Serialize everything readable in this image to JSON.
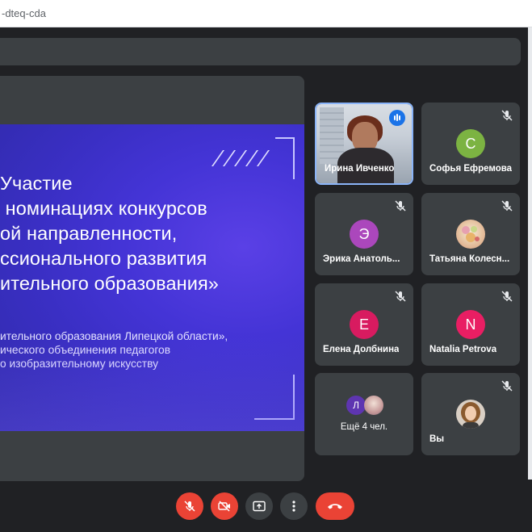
{
  "browser": {
    "url_fragment": "-dteq-cda"
  },
  "presentation": {
    "title_lines": "Участие\n номинациях конкурсов\nой направленности,\nссионального развития\nительного образования»",
    "subtitle_lines": "ительного образования Липецкой области»,\nического объединения педагогов\nо изобразительному искусству"
  },
  "participants": [
    {
      "name": "Ирина Ивченко",
      "kind": "video",
      "speaking": true
    },
    {
      "name": "Софья Ефремова",
      "initial": "С",
      "color": "#7cb342",
      "muted": true
    },
    {
      "name": "Эрика Анатоль...",
      "initial": "Э",
      "color": "#ab47bc",
      "muted": true
    },
    {
      "name": "Татьяна Колесн...",
      "kind": "photo",
      "muted": true
    },
    {
      "name": "Елена Долбнина",
      "initial": "Е",
      "color": "#d81b60",
      "muted": true
    },
    {
      "name": "Natalia Petrova",
      "initial": "N",
      "color": "#e91e63",
      "muted": true
    },
    {
      "name": "Ещё 4 чел.",
      "kind": "more",
      "mini_initial": "Л",
      "mini_color": "#5e35b1"
    },
    {
      "name": "Вы",
      "kind": "photo",
      "muted": true
    }
  ],
  "colors": {
    "control_red": "#ea4335",
    "control_gray": "#3c4043",
    "accent_blue": "#8ab4f8"
  },
  "controls": [
    "mic-off-icon",
    "camera-off-icon",
    "present-icon",
    "more-icon",
    "hang-up-icon"
  ]
}
